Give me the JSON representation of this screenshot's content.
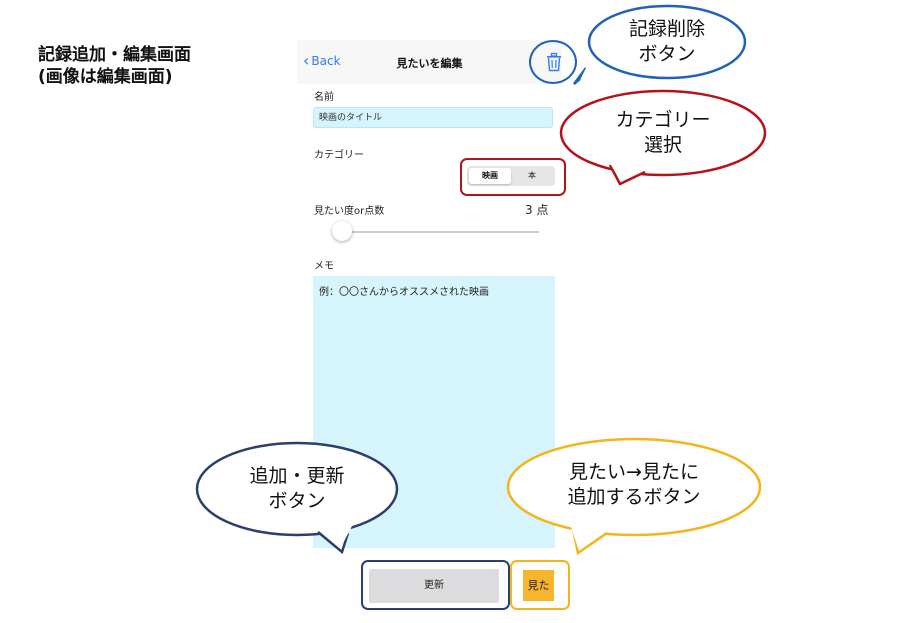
{
  "caption": {
    "line1": "記録追加・編集画面",
    "line2": "(画像は編集画面)"
  },
  "navbar": {
    "back_label": "Back",
    "title": "見たいを編集",
    "trash_icon": "trash-icon"
  },
  "form": {
    "name_label": "名前",
    "name_value": "映画のタイトル",
    "category_label": "カテゴリー",
    "category_options": [
      "映画",
      "本"
    ],
    "category_selected": "映画",
    "score_label": "見たい度or点数",
    "score_value": "3 点",
    "score_level": 0,
    "memo_label": "メモ",
    "memo_value": "例：〇〇さんからオススメされた映画",
    "update_button": "更新",
    "watched_button": "見た"
  },
  "annotations": {
    "delete": {
      "line1": "記録削除",
      "line2": "ボタン"
    },
    "category": {
      "line1": "カテゴリー",
      "line2": "選択"
    },
    "update": {
      "line1": "追加・更新",
      "line2": "ボタン"
    },
    "watched": {
      "line1": "見たい→見たに",
      "line2": "追加するボタン"
    }
  },
  "colors": {
    "accent": "#2f7cf6",
    "field_bg": "#d6f4fb",
    "watched_btn": "#f7b52e",
    "red": "#b5121b",
    "navy": "#2a3f6e",
    "gold": "#f2b51c",
    "blue": "#1f63b7"
  }
}
